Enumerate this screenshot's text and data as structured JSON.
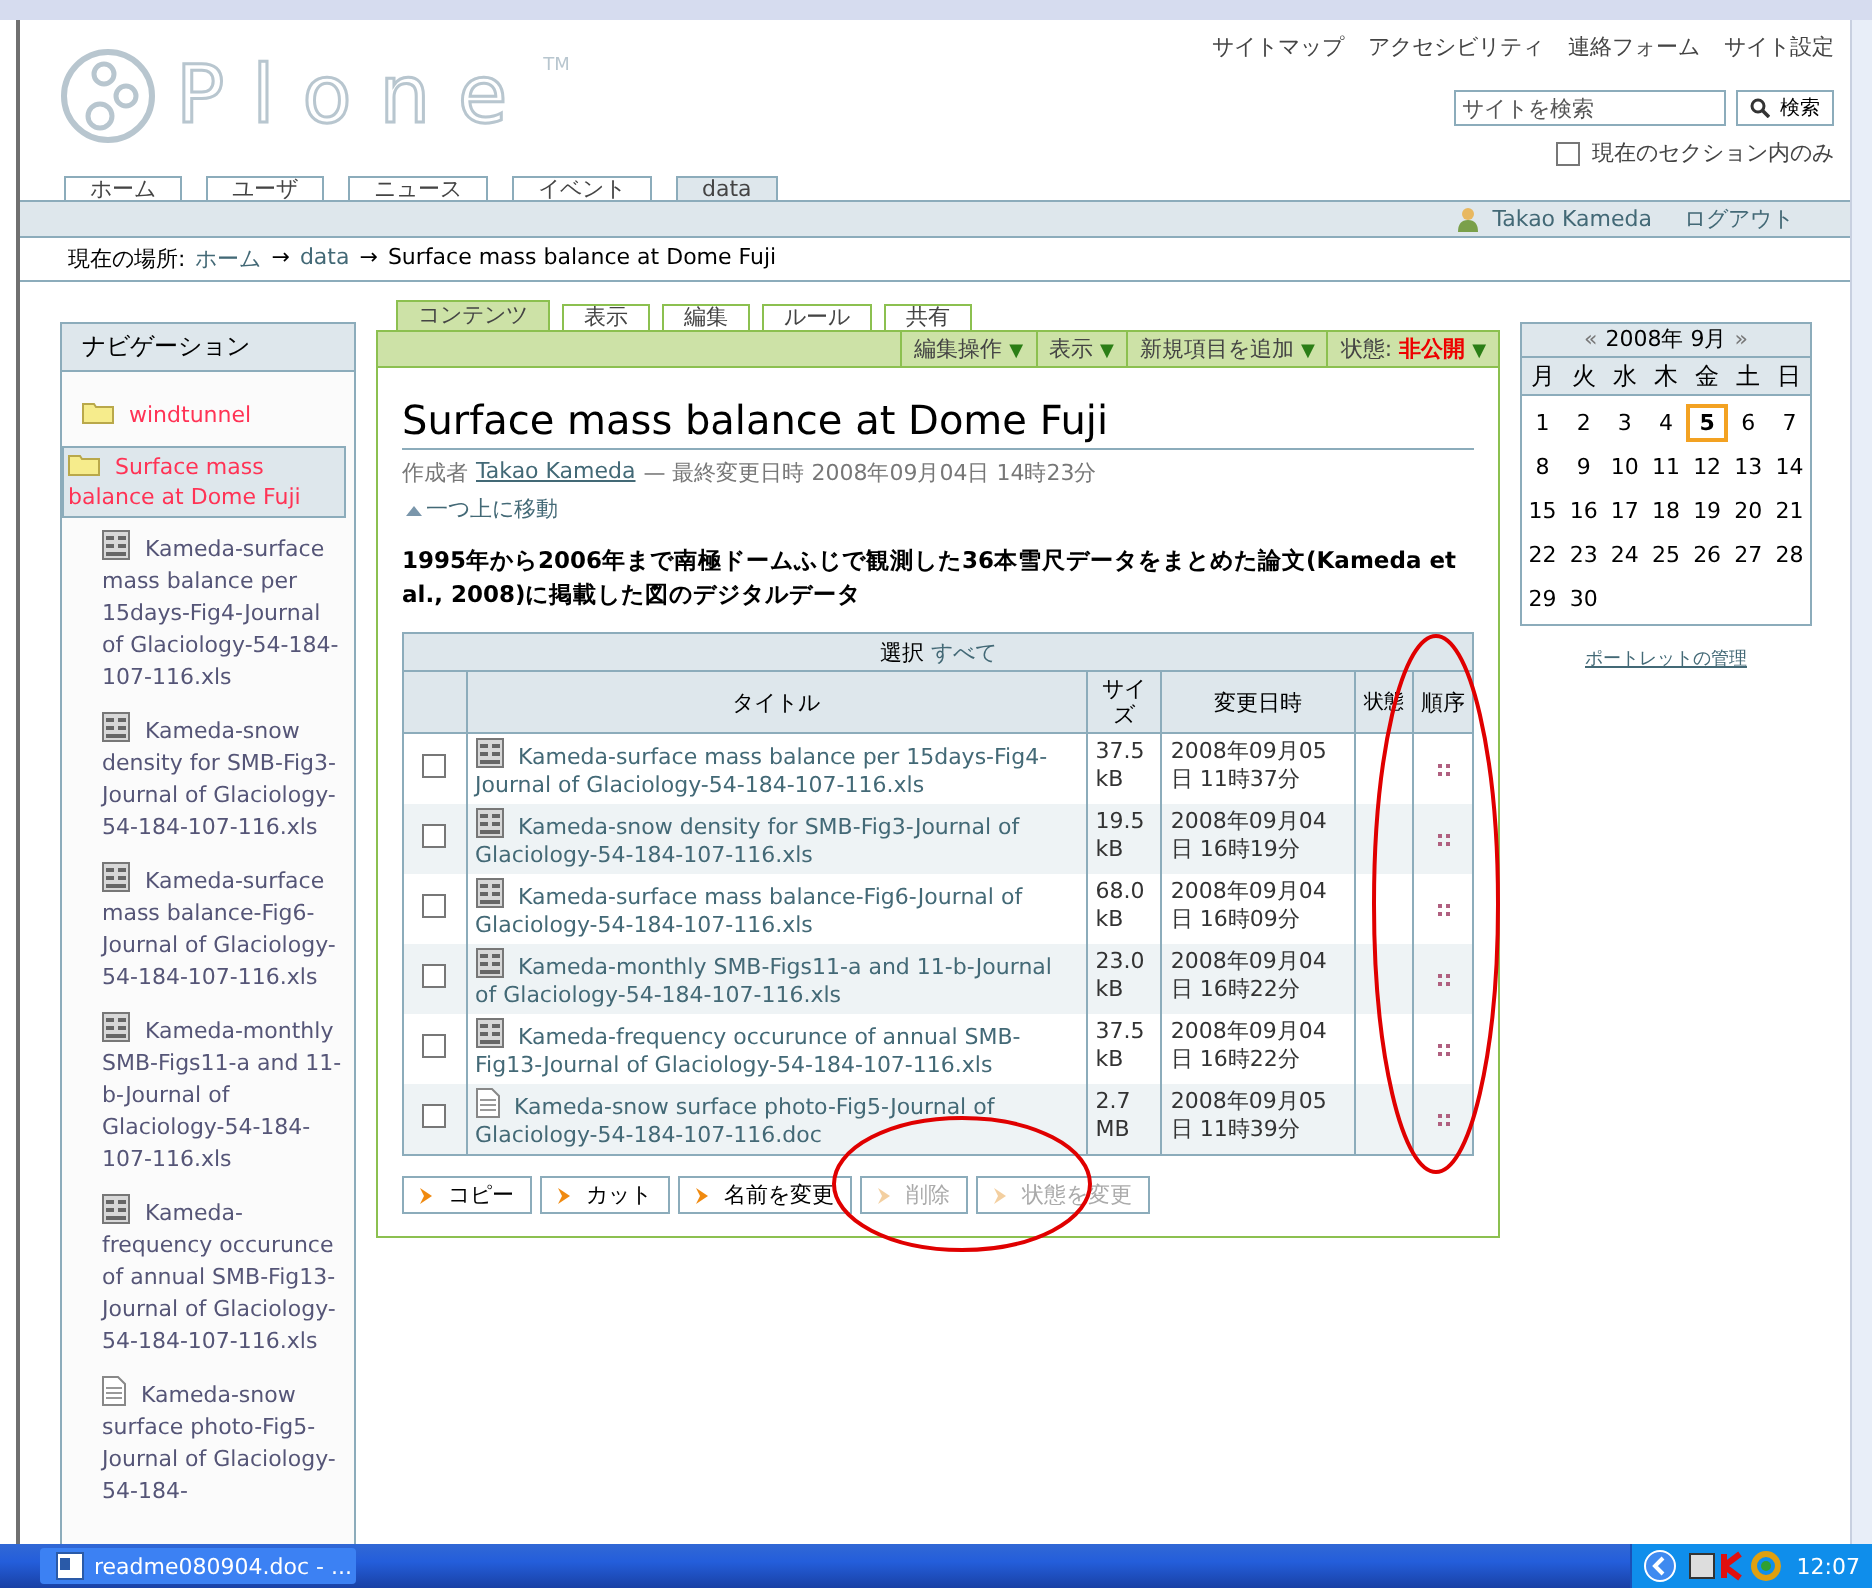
{
  "header": {
    "logo": "Plone",
    "logo_mark": "TM",
    "site_links": [
      "サイトマップ",
      "アクセシビリティ",
      "連絡フォーム",
      "サイト設定"
    ],
    "search": {
      "placeholder": "サイトを検索",
      "button": "検索"
    },
    "section_only": {
      "label": "現在のセクション内のみ",
      "checked": false
    }
  },
  "top_tabs": [
    {
      "label": "ホーム",
      "selected": false
    },
    {
      "label": "ユーザ",
      "selected": false
    },
    {
      "label": "ニュース",
      "selected": false
    },
    {
      "label": "イベント",
      "selected": false
    },
    {
      "label": "data",
      "selected": true
    }
  ],
  "user_bar": {
    "user": "Takao Kameda",
    "logout": "ログアウト"
  },
  "breadcrumb": {
    "label": "現在の場所:",
    "items": [
      {
        "text": "ホーム",
        "kind": "link"
      },
      {
        "text": "→",
        "kind": "separator"
      },
      {
        "text": "data",
        "kind": "link"
      },
      {
        "text": "→",
        "kind": "separator"
      },
      {
        "text": "Surface mass balance at Dome Fuji",
        "kind": "current"
      }
    ]
  },
  "navigation": {
    "title": "ナビゲーション",
    "items": [
      {
        "label": "windtunnel",
        "kind": "folder",
        "selected": false
      },
      {
        "label": "Surface mass balance at Dome Fuji",
        "kind": "folder",
        "selected": true,
        "children": [
          {
            "label": "Kameda-surface mass balance per 15days-Fig4-Journal of Glaciology-54-184-107-116.xls",
            "kind": "spreadsheet",
            "selected": false
          },
          {
            "label": "Kameda-snow density for SMB-Fig3-Journal of Glaciology-54-184-107-116.xls",
            "kind": "spreadsheet",
            "selected": false
          },
          {
            "label": "Kameda-surface mass balance-Fig6-Journal of Glaciology-54-184-107-116.xls",
            "kind": "spreadsheet",
            "selected": false
          },
          {
            "label": "Kameda-monthly SMB-Figs11-a and 11-b-Journal of Glaciology-54-184-107-116.xls",
            "kind": "spreadsheet",
            "selected": false
          },
          {
            "label": "Kameda-frequency occurunce of annual SMB-Fig13-Journal of Glaciology-54-184-107-116.xls",
            "kind": "spreadsheet",
            "selected": false
          },
          {
            "label": "Kameda-snow surface photo-Fig5-Journal of Glaciology-54-184-",
            "kind": "document",
            "selected": false
          }
        ]
      }
    ]
  },
  "content": {
    "tabs": [
      {
        "label": "コンテンツ",
        "selected": true
      },
      {
        "label": "表示",
        "selected": false
      },
      {
        "label": "編集",
        "selected": false
      },
      {
        "label": "ルール",
        "selected": false
      },
      {
        "label": "共有",
        "selected": false
      }
    ],
    "actions": [
      {
        "kind": "menu",
        "label": "編集操作",
        "arrow": "▼"
      },
      {
        "kind": "menu",
        "label": "表示",
        "arrow": "▼"
      },
      {
        "kind": "menu",
        "label": "新規項目を追加",
        "arrow": "▼"
      },
      {
        "kind": "state",
        "label": "状態:",
        "value": "非公開",
        "arrow": "▼"
      }
    ],
    "title": "Surface mass balance at Dome Fuji",
    "byline": {
      "prefix": "作成者",
      "author": "Takao Kameda",
      "modified": "— 最終変更日時 2008年09月04日 14時23分"
    },
    "up_link": "一つ上に移動",
    "description": "1995年から2006年まで南極ドームふじで観測した36本雪尺データをまとめた論文(Kameda et al., 2008)に掲載した図のデジタルデータ",
    "table": {
      "select_label": "選択",
      "select_all": "すべて",
      "columns": [
        "タイトル",
        "サイズ",
        "変更日時",
        "状態",
        "順序"
      ],
      "rows": [
        {
          "checked": false,
          "kind": "spreadsheet",
          "title": "Kameda-surface mass balance per 15days-Fig4-Journal of Glaciology-54-184-107-116.xls",
          "size": "37.5 kB",
          "modified": "2008年09月05日 11時37分"
        },
        {
          "checked": false,
          "kind": "spreadsheet",
          "title": "Kameda-snow density for SMB-Fig3-Journal of Glaciology-54-184-107-116.xls",
          "size": "19.5 kB",
          "modified": "2008年09月04日 16時19分"
        },
        {
          "checked": false,
          "kind": "spreadsheet",
          "title": "Kameda-surface mass balance-Fig6-Journal of Glaciology-54-184-107-116.xls",
          "size": "68.0 kB",
          "modified": "2008年09月04日 16時09分"
        },
        {
          "checked": false,
          "kind": "spreadsheet",
          "title": "Kameda-monthly SMB-Figs11-a and 11-b-Journal of Glaciology-54-184-107-116.xls",
          "size": "23.0 kB",
          "modified": "2008年09月04日 16時22分"
        },
        {
          "checked": false,
          "kind": "spreadsheet",
          "title": "Kameda-frequency occurunce of annual SMB-Fig13-Journal of Glaciology-54-184-107-116.xls",
          "size": "37.5 kB",
          "modified": "2008年09月04日 16時22分"
        },
        {
          "checked": false,
          "kind": "document",
          "title": "Kameda-snow surface photo-Fig5-Journal of Glaciology-54-184-107-116.doc",
          "size": "2.7 MB",
          "modified": "2008年09月05日 11時39分"
        }
      ]
    },
    "buttons": [
      {
        "label": "コピー",
        "disabled": false
      },
      {
        "label": "カット",
        "disabled": false
      },
      {
        "label": "名前を変更",
        "disabled": false
      },
      {
        "label": "削除",
        "disabled": true
      },
      {
        "label": "状態を変更",
        "disabled": true
      }
    ]
  },
  "calendar": {
    "prev": "«",
    "month": "2008年 9月",
    "next": "»",
    "weekdays": [
      "月",
      "火",
      "水",
      "木",
      "金",
      "土",
      "日"
    ],
    "days": [
      {
        "label": "1",
        "today": false
      },
      {
        "label": "2",
        "today": false
      },
      {
        "label": "3",
        "today": false
      },
      {
        "label": "4",
        "today": false
      },
      {
        "label": "5",
        "today": true
      },
      {
        "label": "6",
        "today": false
      },
      {
        "label": "7",
        "today": false
      },
      {
        "label": "8",
        "today": false
      },
      {
        "label": "9",
        "today": false
      },
      {
        "label": "10",
        "today": false
      },
      {
        "label": "11",
        "today": false
      },
      {
        "label": "12",
        "today": false
      },
      {
        "label": "13",
        "today": false
      },
      {
        "label": "14",
        "today": false
      },
      {
        "label": "15",
        "today": false
      },
      {
        "label": "16",
        "today": false
      },
      {
        "label": "17",
        "today": false
      },
      {
        "label": "18",
        "today": false
      },
      {
        "label": "19",
        "today": false
      },
      {
        "label": "20",
        "today": false
      },
      {
        "label": "21",
        "today": false
      },
      {
        "label": "22",
        "today": false
      },
      {
        "label": "23",
        "today": false
      },
      {
        "label": "24",
        "today": false
      },
      {
        "label": "25",
        "today": false
      },
      {
        "label": "26",
        "today": false
      },
      {
        "label": "27",
        "today": false
      },
      {
        "label": "28",
        "today": false
      },
      {
        "label": "29",
        "today": false
      },
      {
        "label": "30",
        "today": false
      }
    ]
  },
  "portlet_link": "ポートレットの管理",
  "taskbar": {
    "task": "readme080904.doc - ...",
    "clock": "12:07"
  }
}
